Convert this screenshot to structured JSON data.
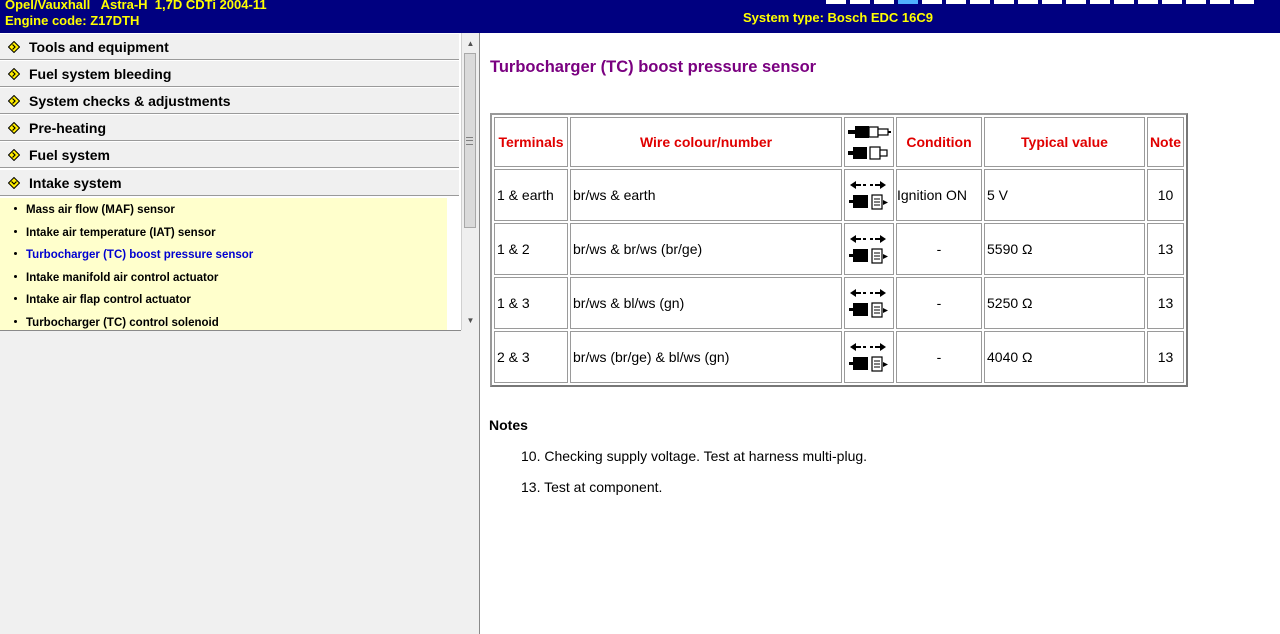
{
  "header": {
    "line1": "Opel/Vauxhall   Astra-H  1,7D CDTi 2004-11",
    "line2": "Engine code: Z17DTH",
    "system": "System type: Bosch EDC 16C9",
    "colors": {
      "bg": "#000080",
      "text": "#ffff00"
    }
  },
  "sidebar": {
    "categories": [
      {
        "label": "Tools and equipment",
        "expanded": false,
        "icon": "yellow-diamond-icon"
      },
      {
        "label": "Fuel system bleeding",
        "expanded": false,
        "icon": "yellow-diamond-icon"
      },
      {
        "label": "System checks & adjustments",
        "expanded": false,
        "icon": "yellow-diamond-icon"
      },
      {
        "label": "Pre-heating",
        "expanded": false,
        "icon": "yellow-diamond-icon"
      },
      {
        "label": "Fuel system",
        "expanded": false,
        "icon": "yellow-diamond-icon"
      },
      {
        "label": "Intake system",
        "expanded": true,
        "icon": "yellow-diamond-icon"
      }
    ],
    "items": [
      {
        "label": "Mass air flow (MAF) sensor",
        "active": false
      },
      {
        "label": "Intake air temperature (IAT) sensor",
        "active": false
      },
      {
        "label": "Turbocharger (TC) boost pressure sensor",
        "active": true
      },
      {
        "label": "Intake manifold air control actuator",
        "active": false
      },
      {
        "label": "Intake air flap control actuator",
        "active": false
      },
      {
        "label": "Turbocharger (TC) control solenoid",
        "active": false
      }
    ],
    "colors": {
      "active": "#0000d0",
      "sublist_bg": "#ffffcc"
    }
  },
  "main": {
    "title": "Turbocharger (TC) boost pressure sensor",
    "title_color": "#7a0080",
    "table": {
      "headers": {
        "terminals": "Terminals",
        "wire": "Wire colour/number",
        "icon": "connector-icon",
        "condition": "Condition",
        "value": "Typical value",
        "note": "Note"
      },
      "header_color": "#e00000",
      "rows": [
        {
          "terminals": "1 & earth",
          "wire": "br/ws & earth",
          "icon": "multimeter-connection-icon",
          "condition": "Ignition ON",
          "value": "5 V",
          "note": "10"
        },
        {
          "terminals": "1 & 2",
          "wire": "br/ws & br/ws (br/ge)",
          "icon": "multimeter-connection-icon",
          "condition": "-",
          "value": "5590 Ω",
          "note": "13"
        },
        {
          "terminals": "1 & 3",
          "wire": "br/ws & bl/ws (gn)",
          "icon": "multimeter-connection-icon",
          "condition": "-",
          "value": "5250 Ω",
          "note": "13"
        },
        {
          "terminals": "2 & 3",
          "wire": "br/ws (br/ge) & bl/ws (gn)",
          "icon": "multimeter-connection-icon",
          "condition": "-",
          "value": "4040 Ω",
          "note": "13"
        }
      ]
    },
    "notes": {
      "heading": "Notes",
      "items": [
        "10. Checking supply voltage. Test at harness multi-plug.",
        "13. Test at component."
      ]
    }
  }
}
